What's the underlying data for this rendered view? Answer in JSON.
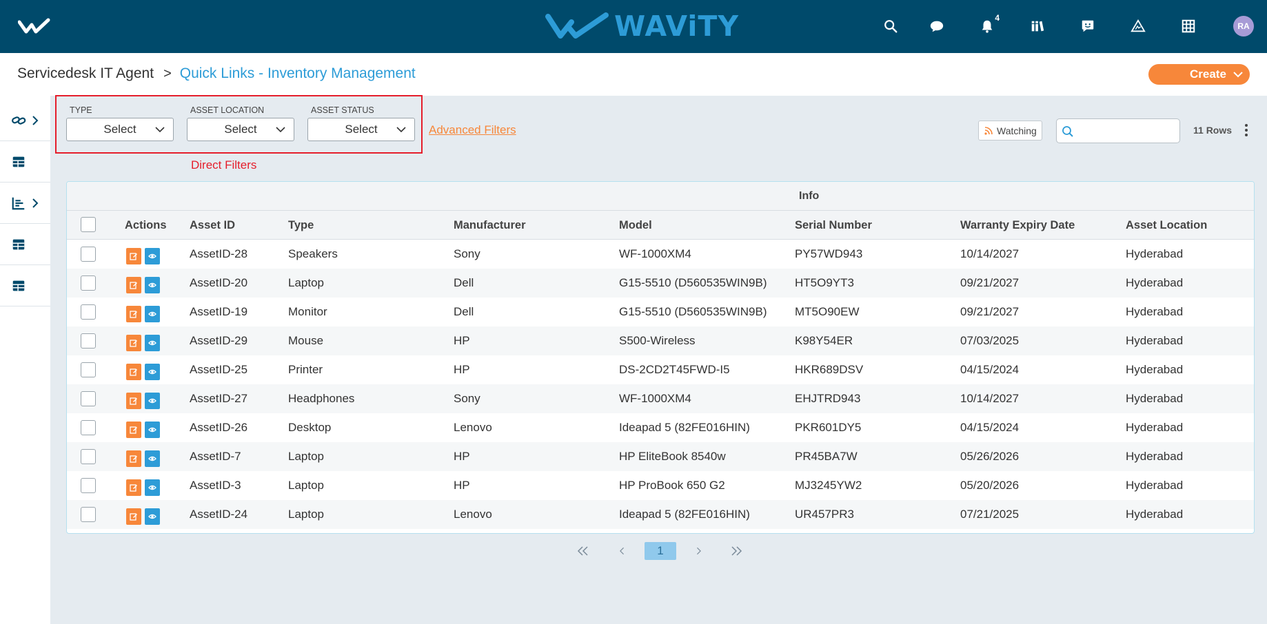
{
  "app": {
    "brand_name": "WAViTY",
    "notification_count": "4",
    "avatar_initials": "RA",
    "colors": {
      "topbar": "#004a6b",
      "accent": "#2d9cd7",
      "primary_action": "#f7873a",
      "highlight": "#e51e2b"
    }
  },
  "top_icons": [
    "search-icon",
    "chat-icon",
    "bell-icon",
    "library-icon",
    "feedback-icon",
    "alert-icon",
    "grid-icon"
  ],
  "breadcrumb": {
    "root": "Servicedesk IT Agent",
    "separator": ">",
    "current": "Quick Links - Inventory Management"
  },
  "create_button": {
    "label": "Create"
  },
  "sidebar": {
    "items": [
      "link-icon",
      "table-icon",
      "chart-icon",
      "table-icon",
      "table-icon"
    ]
  },
  "filters": {
    "type": {
      "label": "TYPE",
      "value": "Select"
    },
    "asset_location": {
      "label": "ASSET LOCATION",
      "value": "Select"
    },
    "asset_status": {
      "label": "ASSET STATUS",
      "value": "Select"
    },
    "annotation": "Direct Filters",
    "advanced_link": "Advanced Filters"
  },
  "toolbar": {
    "watching_label": "Watching",
    "search_value": "",
    "rows_count": "11 Rows"
  },
  "table": {
    "group_header": "Info",
    "columns": [
      "Actions",
      "Asset ID",
      "Type",
      "Manufacturer",
      "Model",
      "Serial Number",
      "Warranty Expiry Date",
      "Asset Location"
    ],
    "rows": [
      [
        "AssetID-28",
        "Speakers",
        "Sony",
        "WF-1000XM4",
        "PY57WD943",
        "10/14/2027",
        "Hyderabad"
      ],
      [
        "AssetID-20",
        "Laptop",
        "Dell",
        "G15-5510 (D560535WIN9B)",
        "HT5O9YT3",
        "09/21/2027",
        "Hyderabad"
      ],
      [
        "AssetID-19",
        "Monitor",
        "Dell",
        "G15-5510 (D560535WIN9B)",
        "MT5O90EW",
        "09/21/2027",
        "Hyderabad"
      ],
      [
        "AssetID-29",
        "Mouse",
        "HP",
        "S500-Wireless",
        "K98Y54ER",
        "07/03/2025",
        "Hyderabad"
      ],
      [
        "AssetID-25",
        "Printer",
        "HP",
        "DS-2CD2T45FWD-I5",
        "HKR689DSV",
        "04/15/2024",
        "Hyderabad"
      ],
      [
        "AssetID-27",
        "Headphones",
        "Sony",
        "WF-1000XM4",
        "EHJTRD943",
        "10/14/2027",
        "Hyderabad"
      ],
      [
        "AssetID-26",
        "Desktop",
        "Lenovo",
        "Ideapad 5 (82FE016HIN)",
        "PKR601DY5",
        "04/15/2024",
        "Hyderabad"
      ],
      [
        "AssetID-7",
        "Laptop",
        "HP",
        "HP EliteBook 8540w",
        "PR45BA7W",
        "05/26/2026",
        "Hyderabad"
      ],
      [
        "AssetID-3",
        "Laptop",
        "HP",
        "HP ProBook 650 G2",
        "MJ3245YW2",
        "05/20/2026",
        "Hyderabad"
      ],
      [
        "AssetID-24",
        "Laptop",
        "Lenovo",
        "Ideapad 5 (82FE016HIN)",
        "UR457PR3",
        "07/21/2025",
        "Hyderabad"
      ]
    ]
  },
  "pagination": {
    "current_page": "1"
  }
}
